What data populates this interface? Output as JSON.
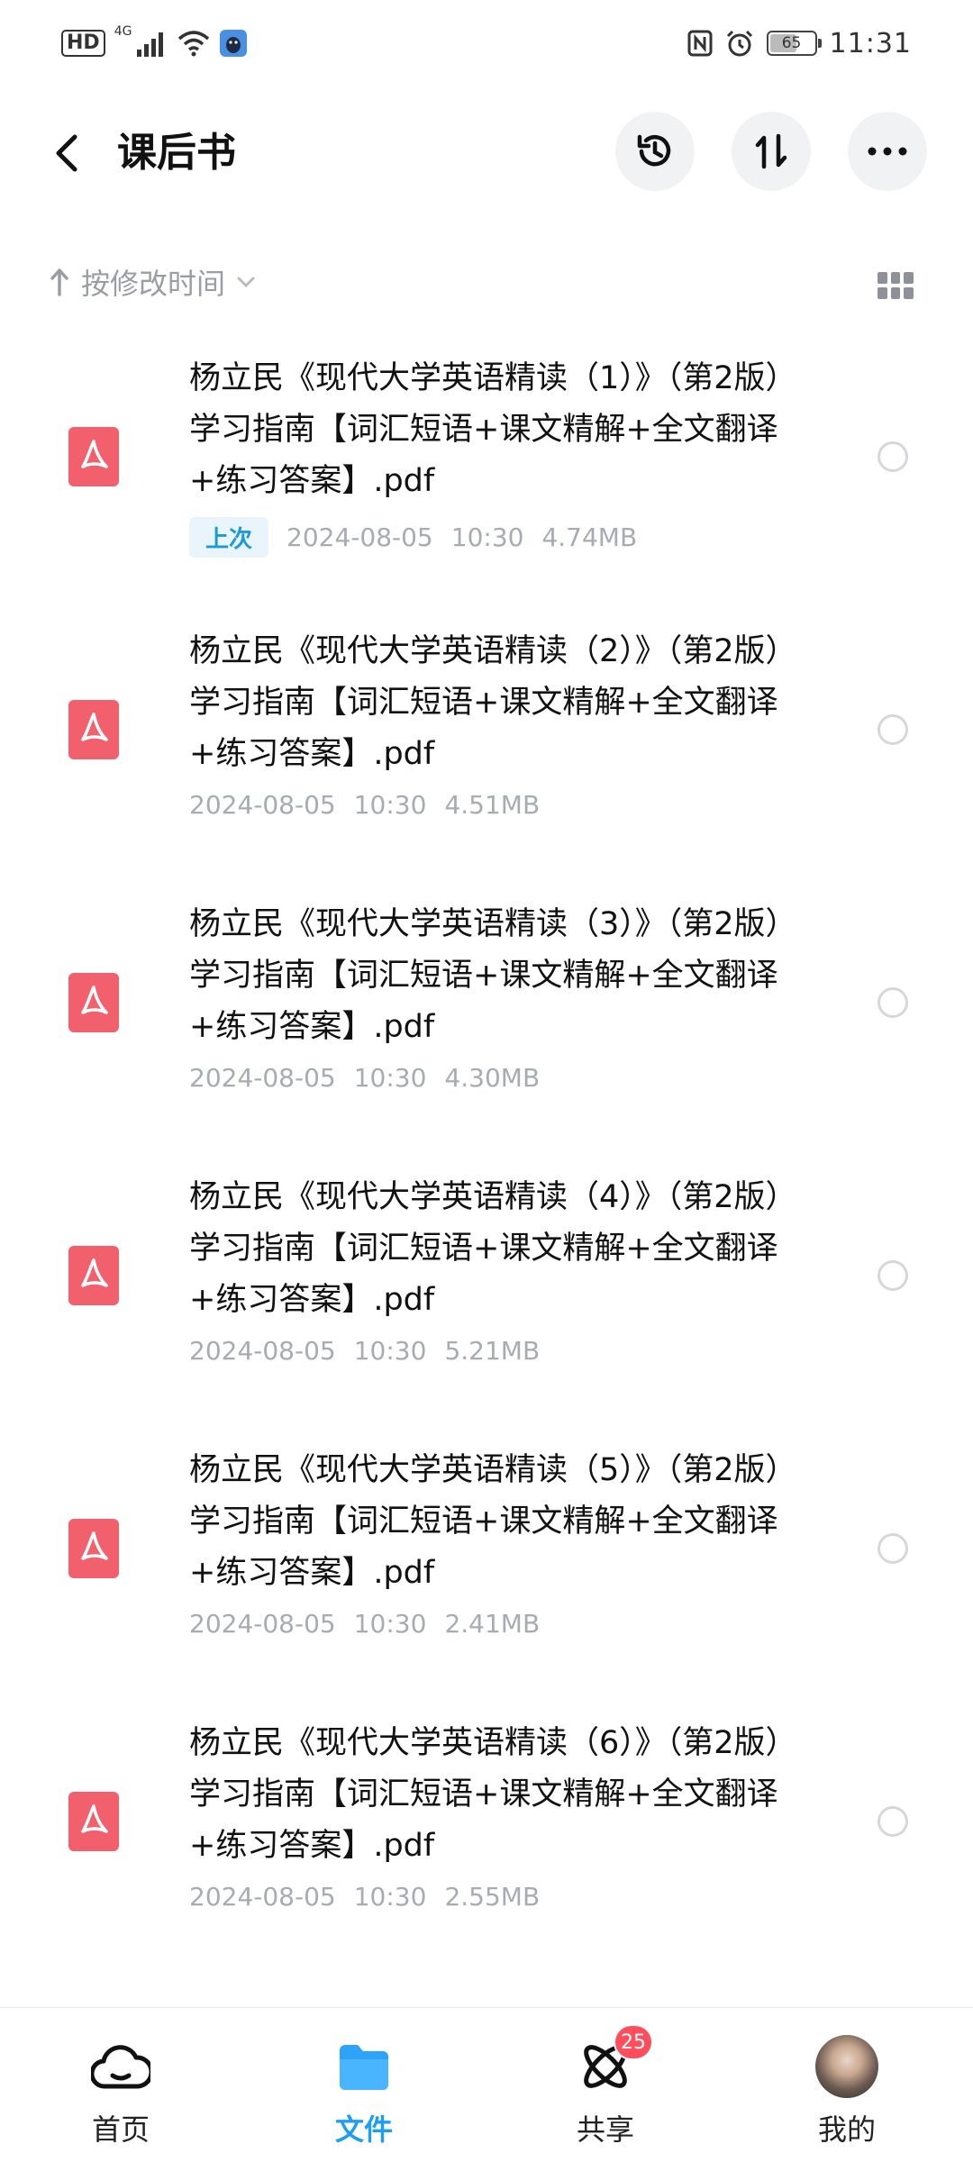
{
  "status_bar": {
    "hd": "HD",
    "network": "4G",
    "battery": "65",
    "battery_level": 0.65,
    "time": "11:31"
  },
  "header": {
    "title": "课后书",
    "icons": [
      "back-arrow-icon",
      "history-icon",
      "sort-swap-icon",
      "more-icon"
    ]
  },
  "sort": {
    "label": "按修改时间"
  },
  "files": [
    {
      "name": "杨立民《现代大学英语精读（1）》（第2版）学习指南【词汇短语+课文精解+全文翻译+练习答案】.pdf",
      "badge": "上次",
      "date": "2024-08-05",
      "time": "10:30",
      "size": "4.74MB"
    },
    {
      "name": "杨立民《现代大学英语精读（2）》（第2版）学习指南【词汇短语+课文精解+全文翻译+练习答案】.pdf",
      "date": "2024-08-05",
      "time": "10:30",
      "size": "4.51MB"
    },
    {
      "name": "杨立民《现代大学英语精读（3）》（第2版）学习指南【词汇短语+课文精解+全文翻译+练习答案】.pdf",
      "date": "2024-08-05",
      "time": "10:30",
      "size": "4.30MB"
    },
    {
      "name": "杨立民《现代大学英语精读（4）》（第2版）学习指南【词汇短语+课文精解+全文翻译+练习答案】.pdf",
      "date": "2024-08-05",
      "time": "10:30",
      "size": "5.21MB"
    },
    {
      "name": "杨立民《现代大学英语精读（5）》（第2版）学习指南【词汇短语+课文精解+全文翻译+练习答案】.pdf",
      "date": "2024-08-05",
      "time": "10:30",
      "size": "2.41MB"
    },
    {
      "name": "杨立民《现代大学英语精读（6）》（第2版）学习指南【词汇短语+课文精解+全文翻译+练习答案】.pdf",
      "date": "2024-08-05",
      "time": "10:30",
      "size": "2.55MB"
    }
  ],
  "nav": {
    "tabs": [
      {
        "label": "首页",
        "icon": "cloud-icon"
      },
      {
        "label": "文件",
        "icon": "folder-icon",
        "active": true
      },
      {
        "label": "共享",
        "icon": "atom-icon",
        "badge": "25"
      },
      {
        "label": "我的",
        "icon": "avatar"
      }
    ]
  },
  "colors": {
    "accent": "#1c9ef6",
    "pdf_icon": "#f2606d",
    "badge_bg": "#eaf5fb",
    "badge_text": "#1b9ad6",
    "meta_text": "#a7abb3",
    "notif": "#ff4d5b"
  }
}
